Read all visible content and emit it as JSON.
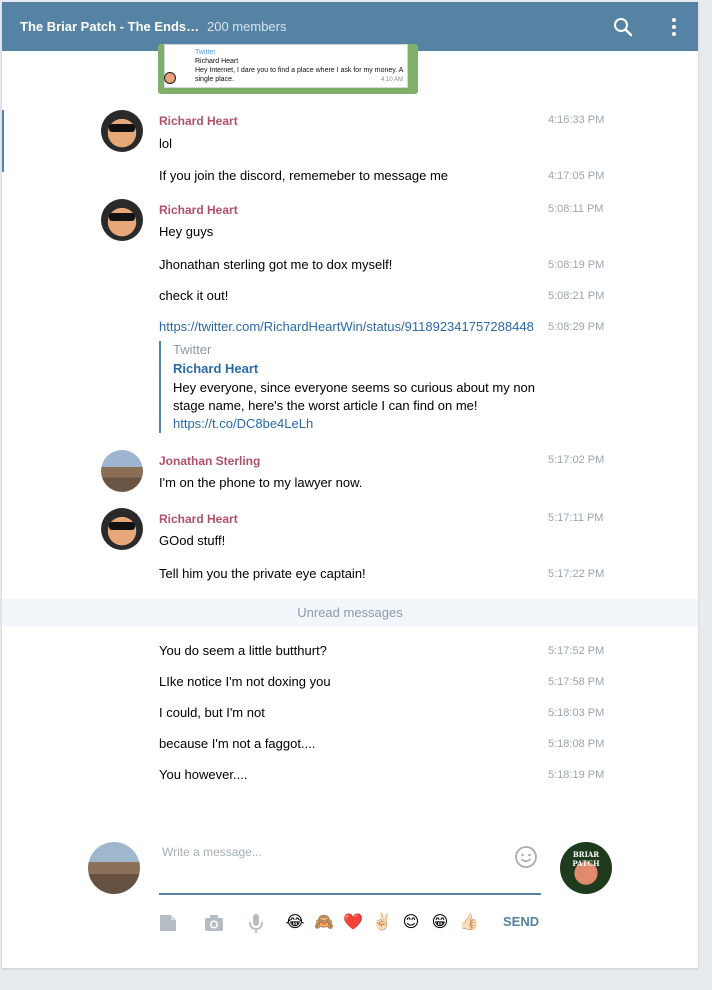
{
  "header": {
    "title": "The Briar Patch - The Ends…",
    "members": "200 members",
    "icons": {
      "search": "search-icon",
      "more": "more-vertical-icon"
    }
  },
  "embed_thumb": {
    "site": "Twitter",
    "author": "Richard Heart",
    "text": "Hey Internet, I dare you to find a place where I ask for my money. A single place.",
    "time": "4:10 AM"
  },
  "messages": [
    {
      "author": "Richard Heart",
      "text": "lol",
      "time": "4:16:33 PM"
    },
    {
      "text": "If you join the discord, rememeber to message me",
      "time": "4:17:05 PM"
    },
    {
      "author": "Richard Heart",
      "text": "Hey guys",
      "time": "5:08:11 PM"
    },
    {
      "text": "Jhonathan sterling got me to dox myself!",
      "time": "5:08:19 PM"
    },
    {
      "text": "check it out!",
      "time": "5:08:21 PM"
    },
    {
      "link": "https://twitter.com/RichardHeartWin/status/911892341757288448",
      "time": "5:08:29 PM"
    },
    {
      "author": "Jonathan Sterling",
      "text": "I'm on the phone to my lawyer now.",
      "time": "5:17:02 PM"
    },
    {
      "author": "Richard Heart",
      "text": "GOod stuff!",
      "time": "5:17:11 PM"
    },
    {
      "text": "Tell him you the private eye captain!",
      "time": "5:17:22 PM"
    },
    {
      "text": "You do seem a little butthurt?",
      "time": "5:17:52 PM"
    },
    {
      "text": "LIke notice I'm not doxing you",
      "time": "5:17:58 PM"
    },
    {
      "text": "I could, but I'm not",
      "time": "5:18:03 PM"
    },
    {
      "text": "because I'm not a faggot....",
      "time": "5:18:08 PM"
    },
    {
      "text": "You however....",
      "time": "5:18:19 PM"
    }
  ],
  "link_preview": {
    "site": "Twitter",
    "title": "Richard Heart",
    "description": "Hey everyone, since everyone seems so curious about my non stage name, here's the worst article I can find on me!",
    "link": "https://t.co/DC8be4LeLh"
  },
  "unread_label": "Unread messages",
  "composer": {
    "placeholder": "Write a message...",
    "send_label": "SEND",
    "icons": [
      "file-icon",
      "camera-icon",
      "microphone-icon",
      "smile-icon"
    ],
    "quick_emojis": [
      "😂",
      "🙈",
      "❤️",
      "✌🏻",
      "😊",
      "😁",
      "👍🏻"
    ]
  },
  "colors": {
    "header": "#5682a3",
    "author": "#b0516a",
    "link": "#2a6aa8",
    "time": "#9aa5b0"
  }
}
